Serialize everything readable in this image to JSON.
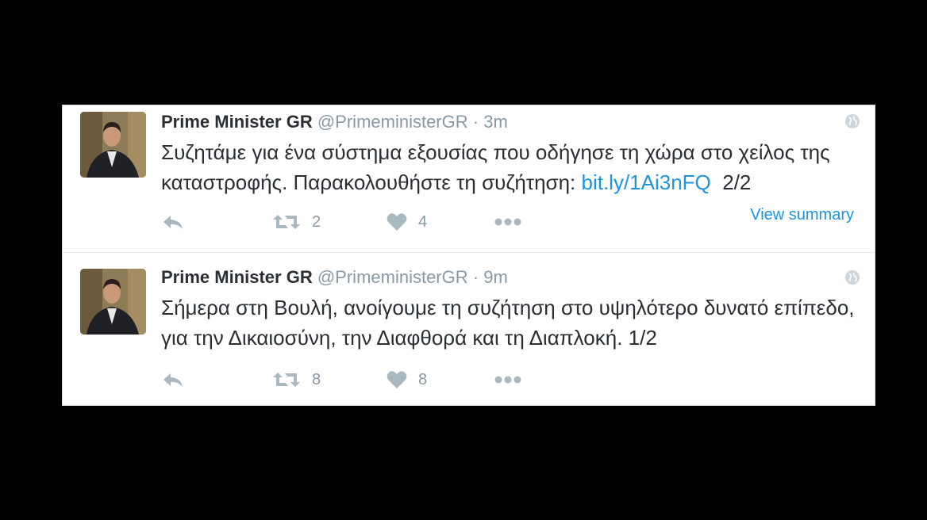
{
  "tweets": [
    {
      "name": "Prime Minister GR",
      "handle": "@PrimeministerGR",
      "dot": "·",
      "time": "3m",
      "text_before_link": "Συζητάμε για ένα σύστημα εξουσίας που οδήγησε τη χώρα στο χείλος της καταστροφής. Παρακολουθήστε τη συζήτηση: ",
      "link": "bit.ly/1Ai3nFQ",
      "text_after_link": "  2/2",
      "retweets": "2",
      "likes": "4",
      "summary_label": "View summary",
      "icons": [
        "reply-icon",
        "retweet-icon",
        "like-icon",
        "more-icon",
        "globe-icon"
      ]
    },
    {
      "name": "Prime Minister GR",
      "handle": "@PrimeministerGR",
      "dot": "·",
      "time": "9m",
      "text": "Σήμερα στη Βουλή, ανοίγουμε τη συζήτηση στο υψηλότερο δυνατό επίπεδο, για την Δικαιοσύνη, την Διαφθορά και τη Διαπλοκή. 1/2",
      "retweets": "8",
      "likes": "8",
      "icons": [
        "reply-icon",
        "retweet-icon",
        "like-icon",
        "more-icon",
        "globe-icon"
      ]
    }
  ],
  "colors": {
    "link": "#1b95e0",
    "muted": "#8899a6",
    "text": "#292f33",
    "icon": "#aab8c2"
  }
}
